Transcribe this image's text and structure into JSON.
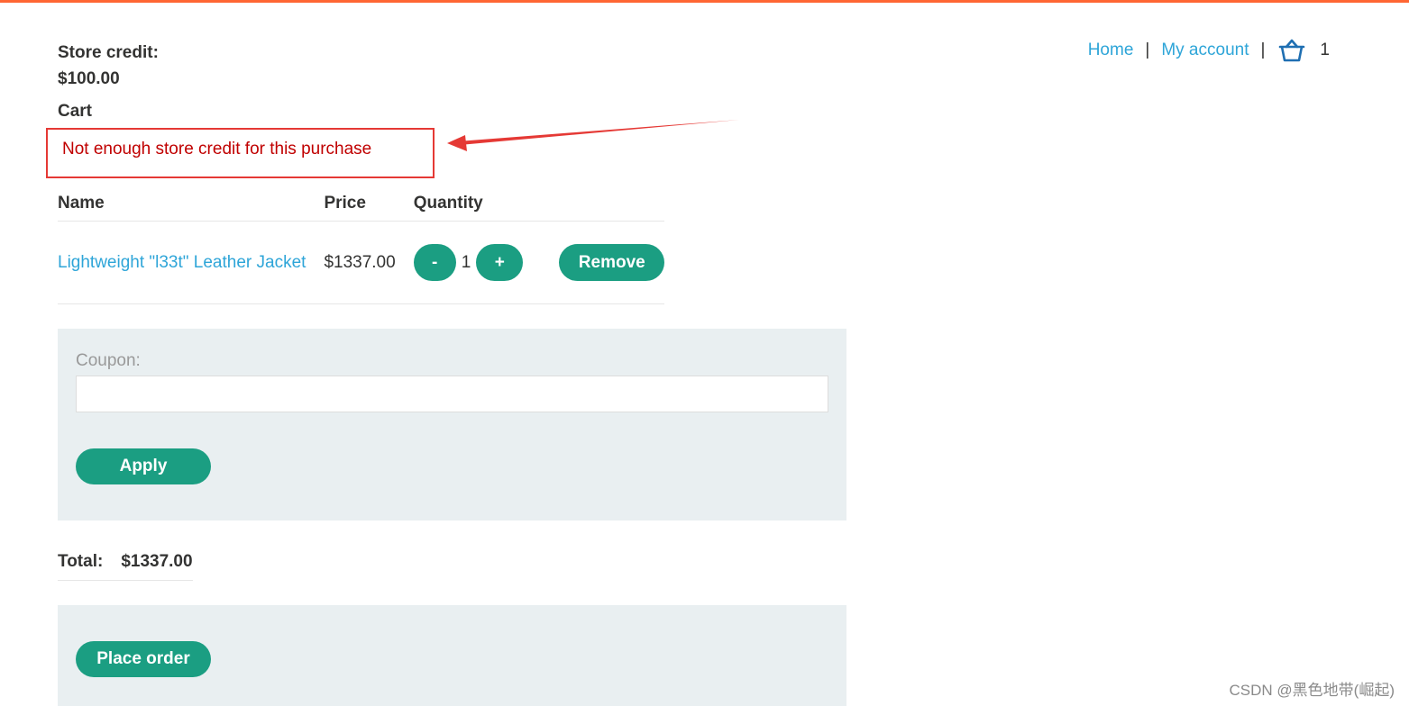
{
  "header": {
    "store_credit_label": "Store credit:",
    "store_credit_value": "$100.00",
    "nav": {
      "home": "Home",
      "separator": "|",
      "my_account": "My account",
      "cart_count": "1"
    }
  },
  "cart": {
    "title": "Cart",
    "error": "Not enough store credit for this purchase",
    "columns": [
      "Name",
      "Price",
      "Quantity"
    ],
    "items": [
      {
        "name": "Lightweight \"l33t\" Leather Jacket",
        "price": "$1337.00",
        "quantity": "1",
        "minus_label": "-",
        "plus_label": "+",
        "remove_label": "Remove"
      }
    ]
  },
  "coupon": {
    "label": "Coupon:",
    "value": "",
    "apply_label": "Apply"
  },
  "totals": {
    "label": "Total:",
    "value": "$1337.00"
  },
  "order": {
    "place_label": "Place order"
  },
  "watermark": "CSDN @黑色地带(崛起)",
  "colors": {
    "accent_bar": "#ff6633",
    "button": "#1b9e82",
    "link": "#2ea5d8",
    "error_text": "#c00000",
    "annotation": "#e53935",
    "panel_bg": "#e9eff1"
  },
  "icons": {
    "cart": "basket-icon"
  }
}
